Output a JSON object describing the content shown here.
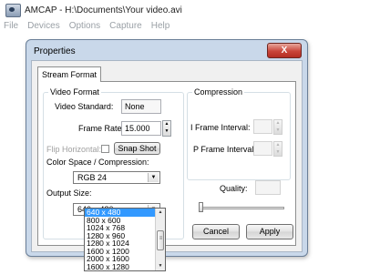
{
  "app": {
    "title": "AMCAP - H:\\Documents\\Your video.avi",
    "menu": [
      "File",
      "Devices",
      "Options",
      "Capture",
      "Help"
    ]
  },
  "dialog": {
    "title": "Properties",
    "close_label": "X",
    "tab_label": "Stream Format",
    "video_format": {
      "legend": "Video Format",
      "standard_label": "Video Standard:",
      "standard_value": "None",
      "frame_rate_label": "Frame Rate:",
      "frame_rate_value": "15.000",
      "flip_label": "Flip Horizontal:",
      "snap_shot_label": "Snap Shot",
      "color_space_label": "Color Space / Compression:",
      "color_space_value": "RGB 24",
      "output_size_label": "Output Size:",
      "output_size_value": "640 x 480"
    },
    "compression": {
      "legend": "Compression",
      "iframe_label": "I Frame Interval:",
      "pframe_label": "P Frame Interval:",
      "quality_label": "Quality:"
    },
    "buttons": {
      "cancel_label": "Cancel",
      "apply_label": "Apply"
    }
  },
  "output_size_options": [
    "640 x 480",
    "800 x 600",
    "1024 x 768",
    "1280 x 960",
    "1280 x 1024",
    "1600 x 1200",
    "2000 x 1600",
    "1600 x 1280"
  ],
  "output_size_selected_index": 0,
  "icons": {
    "app_icon": "camera-icon",
    "spin_up": "▲",
    "spin_down": "▼",
    "combo_arrow": "▼"
  },
  "colors": {
    "selection": "#3399ff",
    "close_button": "#c9453a",
    "dialog_frame": "#c9d8ea",
    "disabled_text": "#a0a0a0",
    "menu_text": "#9aa0a6"
  }
}
